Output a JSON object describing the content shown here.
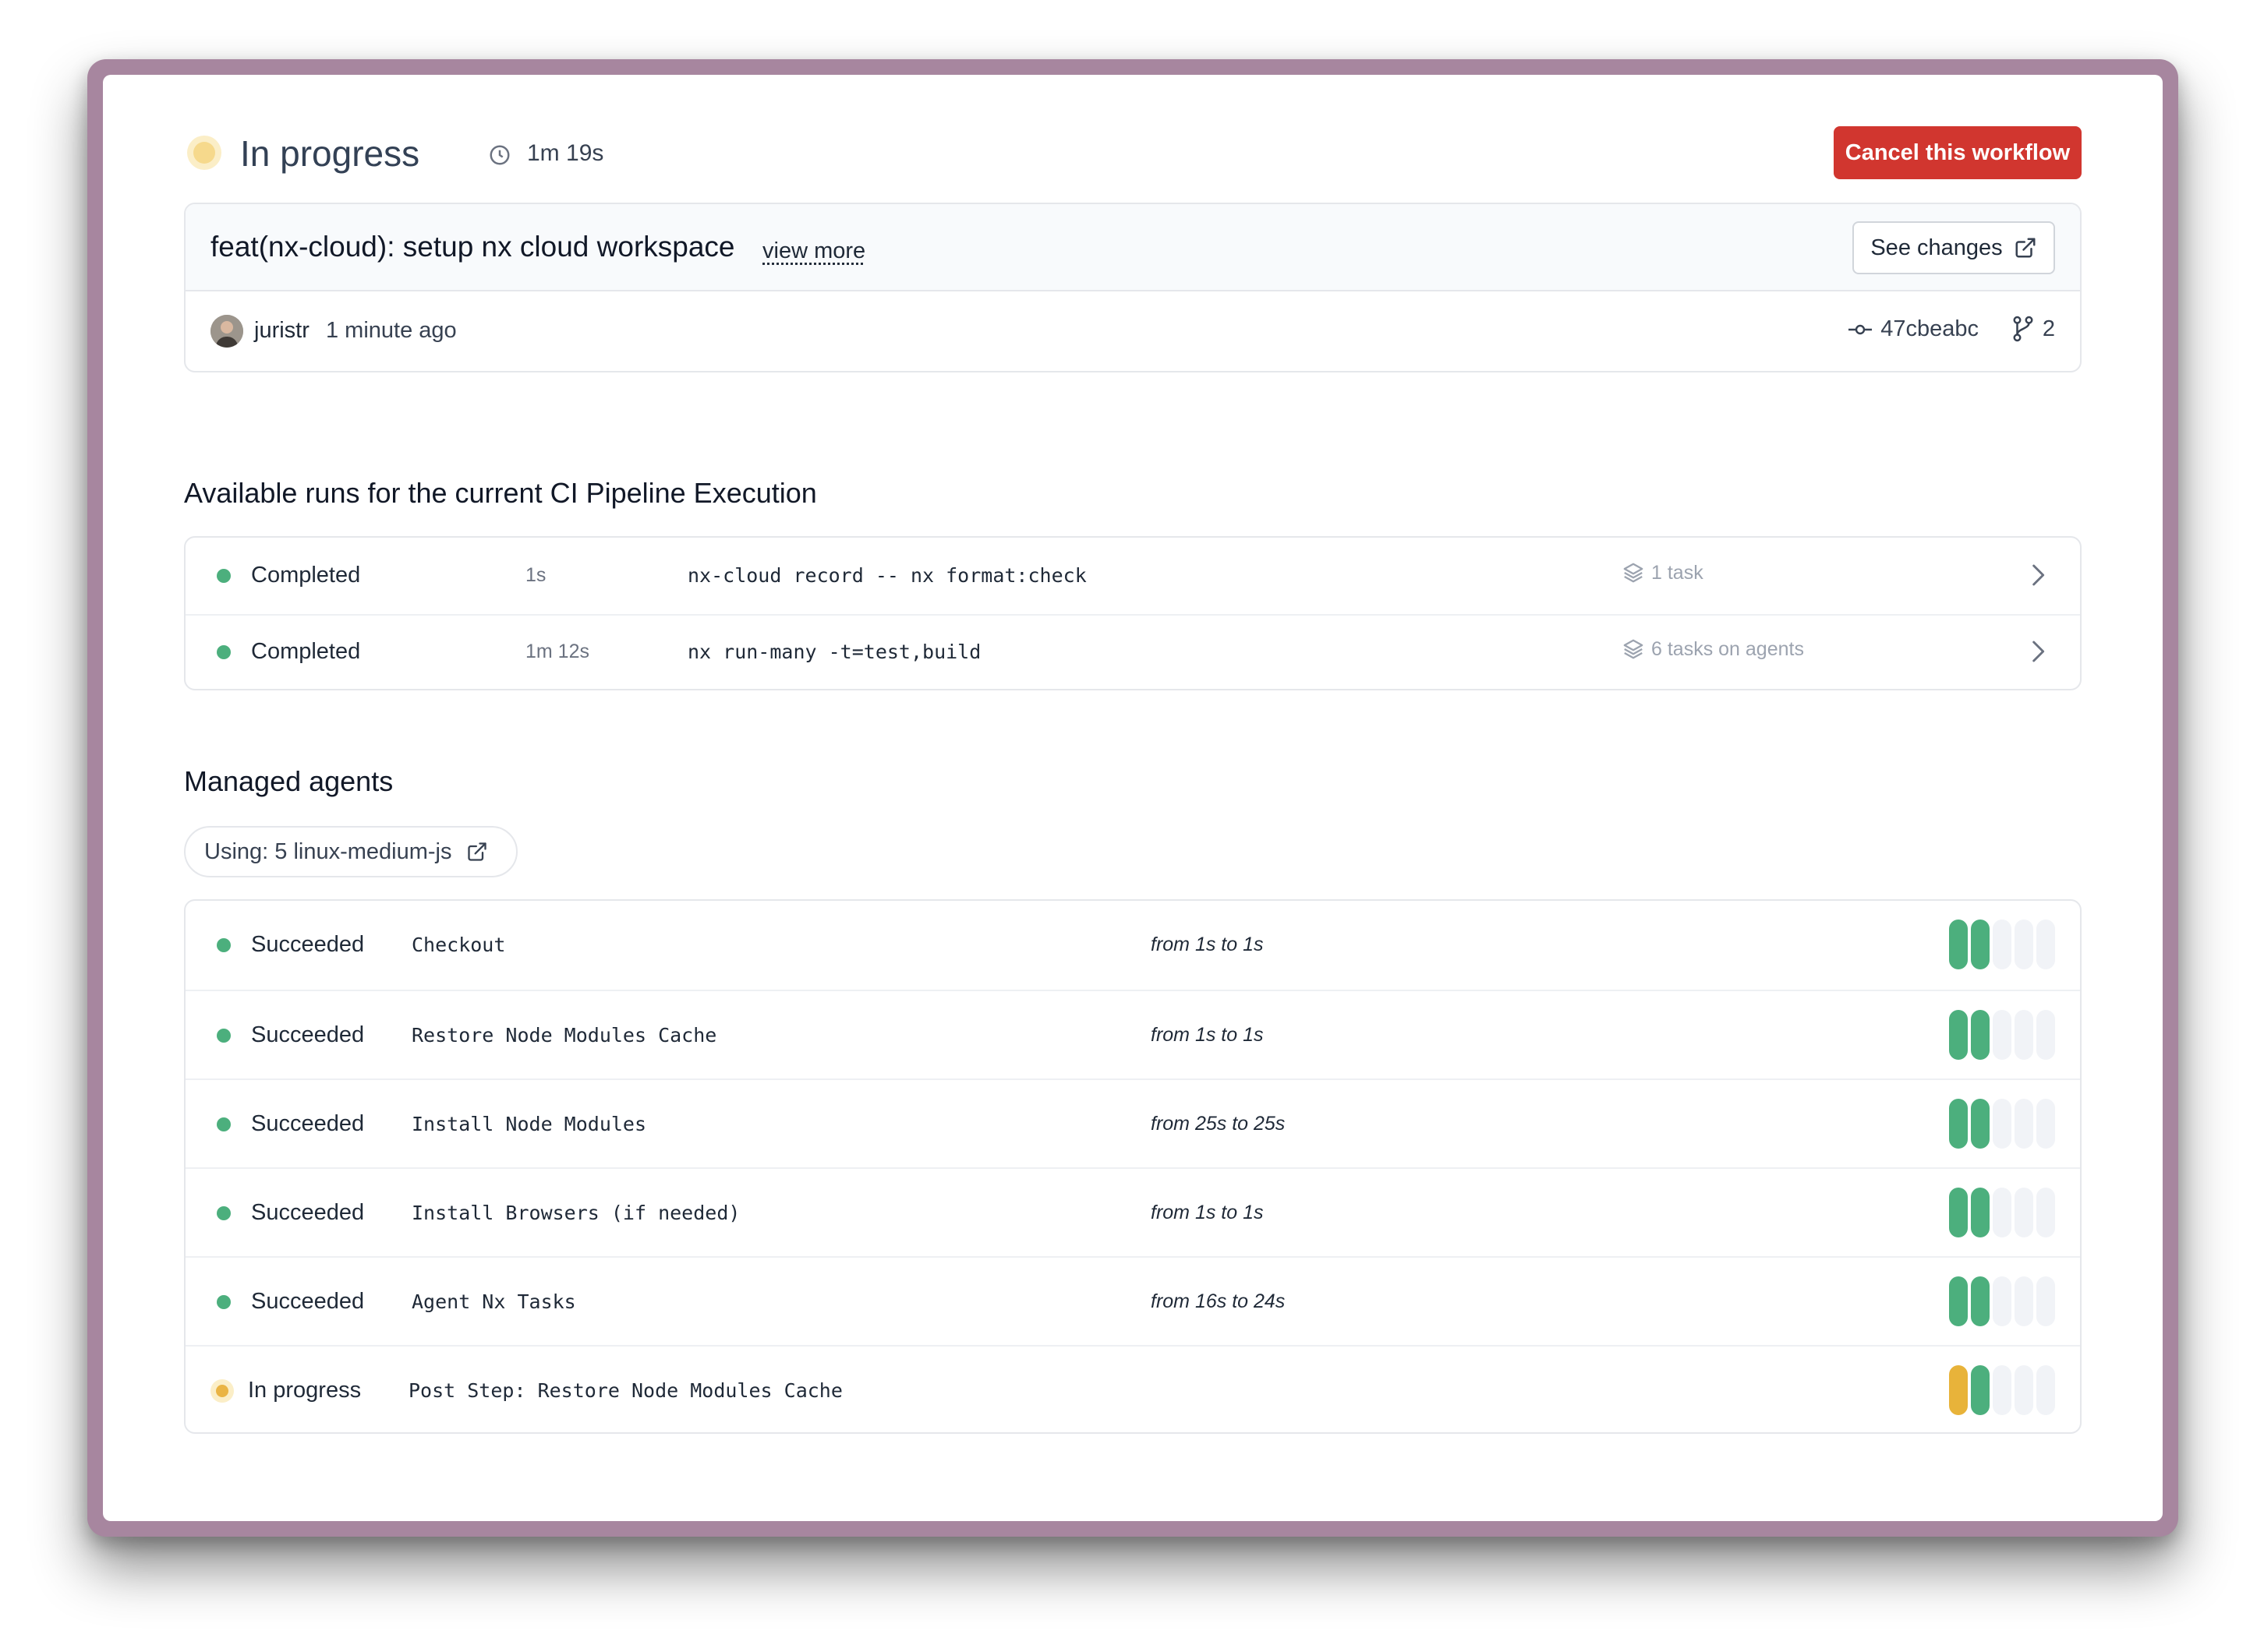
{
  "header": {
    "status": "In progress",
    "duration": "1m 19s",
    "cancel_label": "Cancel this workflow",
    "colors": {
      "cancel": "#d1362f",
      "in_progress": "#f6d98c"
    }
  },
  "commit": {
    "message": "feat(nx-cloud): setup nx cloud workspace",
    "view_more": "view more",
    "see_changes": "See changes",
    "author": "juristr",
    "time_ago": "1 minute ago",
    "hash": "47cbeabc",
    "branch_count": "2"
  },
  "runs_section": {
    "title": "Available runs for the current CI Pipeline Execution",
    "rows": [
      {
        "status": "Completed",
        "duration": "1s",
        "command": "nx-cloud record -- nx format:check",
        "tasks": "1 task"
      },
      {
        "status": "Completed",
        "duration": "1m 12s",
        "command": "nx run-many -t=test,build",
        "tasks": "6 tasks on agents"
      }
    ]
  },
  "agents_section": {
    "title": "Managed agents",
    "using": "Using: 5 linux-medium-js",
    "rows": [
      {
        "status": "Succeeded",
        "step": "Checkout",
        "range": "from 1s to 1s",
        "bars": [
          "green",
          "green",
          "empty",
          "empty",
          "empty"
        ]
      },
      {
        "status": "Succeeded",
        "step": "Restore Node Modules Cache",
        "range": "from 1s to 1s",
        "bars": [
          "green",
          "green",
          "empty",
          "empty",
          "empty"
        ]
      },
      {
        "status": "Succeeded",
        "step": "Install Node Modules",
        "range": "from 25s to 25s",
        "bars": [
          "green",
          "green",
          "empty",
          "empty",
          "empty"
        ]
      },
      {
        "status": "Succeeded",
        "step": "Install Browsers (if needed)",
        "range": "from 1s to 1s",
        "bars": [
          "green",
          "green",
          "empty",
          "empty",
          "empty"
        ]
      },
      {
        "status": "Succeeded",
        "step": "Agent Nx Tasks",
        "range": "from 16s to 24s",
        "bars": [
          "green",
          "green",
          "empty",
          "empty",
          "empty"
        ]
      },
      {
        "status": "In progress",
        "step": "Post Step: Restore Node Modules Cache",
        "range": "",
        "bars": [
          "yellow",
          "green",
          "empty",
          "empty",
          "empty"
        ]
      }
    ]
  }
}
